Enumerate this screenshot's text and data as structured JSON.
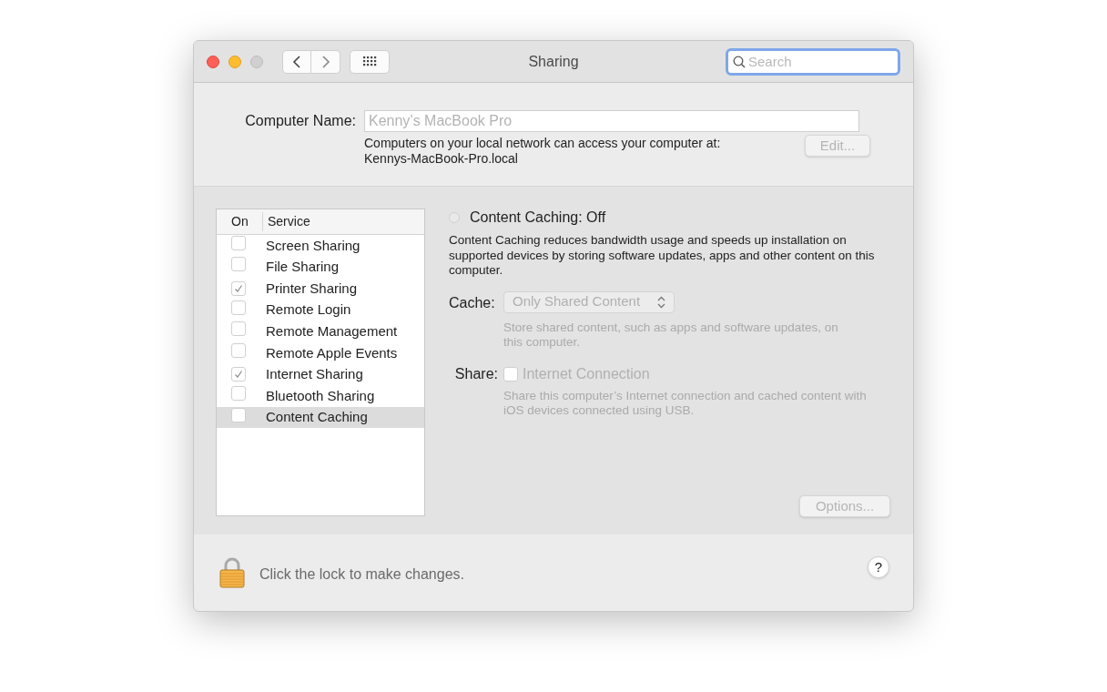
{
  "window": {
    "title": "Sharing"
  },
  "search": {
    "placeholder": "Search"
  },
  "computer_name": {
    "label": "Computer Name:",
    "value": "Kenny’s MacBook Pro",
    "disabled": true,
    "note": [
      "Computers on your local network can access your computer at:",
      "Kennys-MacBook-Pro.local"
    ],
    "edit_button": {
      "label": "Edit...",
      "disabled": true
    }
  },
  "services": {
    "columns": [
      "On",
      "Service"
    ],
    "rows": [
      {
        "name": "Screen Sharing",
        "checked": false,
        "selected": false
      },
      {
        "name": "File Sharing",
        "checked": false,
        "selected": false
      },
      {
        "name": "Printer Sharing",
        "checked": true,
        "selected": false
      },
      {
        "name": "Remote Login",
        "checked": false,
        "selected": false
      },
      {
        "name": "Remote Management",
        "checked": false,
        "selected": false
      },
      {
        "name": "Remote Apple Events",
        "checked": false,
        "selected": false
      },
      {
        "name": "Internet Sharing",
        "checked": true,
        "selected": false
      },
      {
        "name": "Bluetooth Sharing",
        "checked": false,
        "selected": false
      },
      {
        "name": "Content Caching",
        "checked": false,
        "selected": true
      }
    ]
  },
  "detail": {
    "status": {
      "label": "Content Caching: Off",
      "on": false
    },
    "description": "Content Caching reduces bandwidth usage and speeds up installation on supported devices by storing software updates, apps and other content on this computer.",
    "cache": {
      "label": "Cache:",
      "value": "Only Shared Content",
      "disabled": true,
      "hint": "Store shared content, such as apps and software updates, on this computer."
    },
    "share": {
      "label": "Share:",
      "option": "Internet Connection",
      "checked": false,
      "disabled": true,
      "hint": "Share this computer’s Internet connection and cached content with iOS devices connected using USB."
    },
    "options_button": {
      "label": "Options...",
      "disabled": true
    }
  },
  "footer": {
    "lock_text": "Click the lock to make changes.",
    "help": "?"
  }
}
